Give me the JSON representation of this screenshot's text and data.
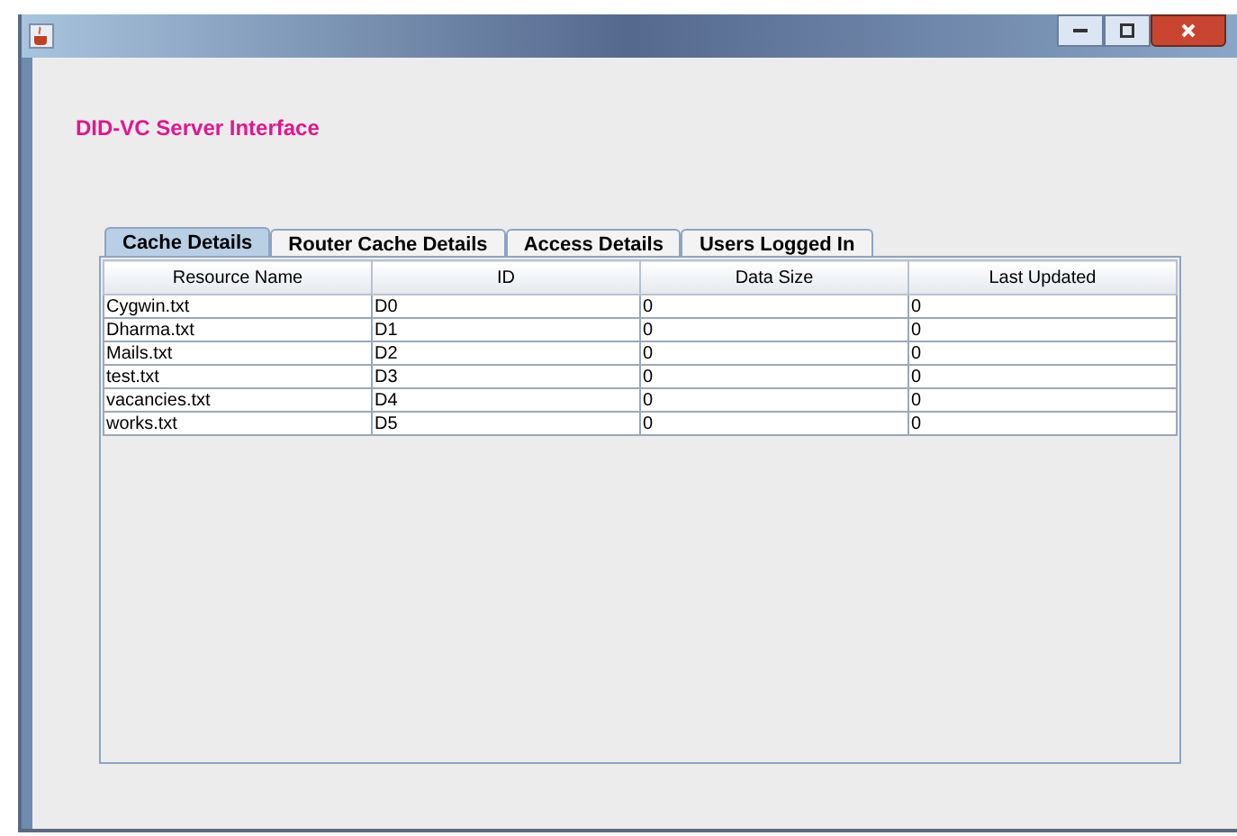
{
  "heading": "DID-VC Server Interface",
  "tabs": [
    {
      "label": "Cache Details",
      "selected": true
    },
    {
      "label": "Router Cache Details",
      "selected": false
    },
    {
      "label": "Access Details",
      "selected": false
    },
    {
      "label": "Users Logged In",
      "selected": false
    }
  ],
  "table": {
    "columns": [
      "Resource Name",
      "ID",
      "Data Size",
      "Last Updated"
    ],
    "rows": [
      [
        "Cygwin.txt",
        "D0",
        "0",
        "0"
      ],
      [
        "Dharma.txt",
        "D1",
        "0",
        "0"
      ],
      [
        "Mails.txt",
        "D2",
        "0",
        "0"
      ],
      [
        "test.txt",
        "D3",
        "0",
        "0"
      ],
      [
        "vacancies.txt",
        "D4",
        "0",
        "0"
      ],
      [
        "works.txt",
        "D5",
        "0",
        "0"
      ]
    ]
  }
}
